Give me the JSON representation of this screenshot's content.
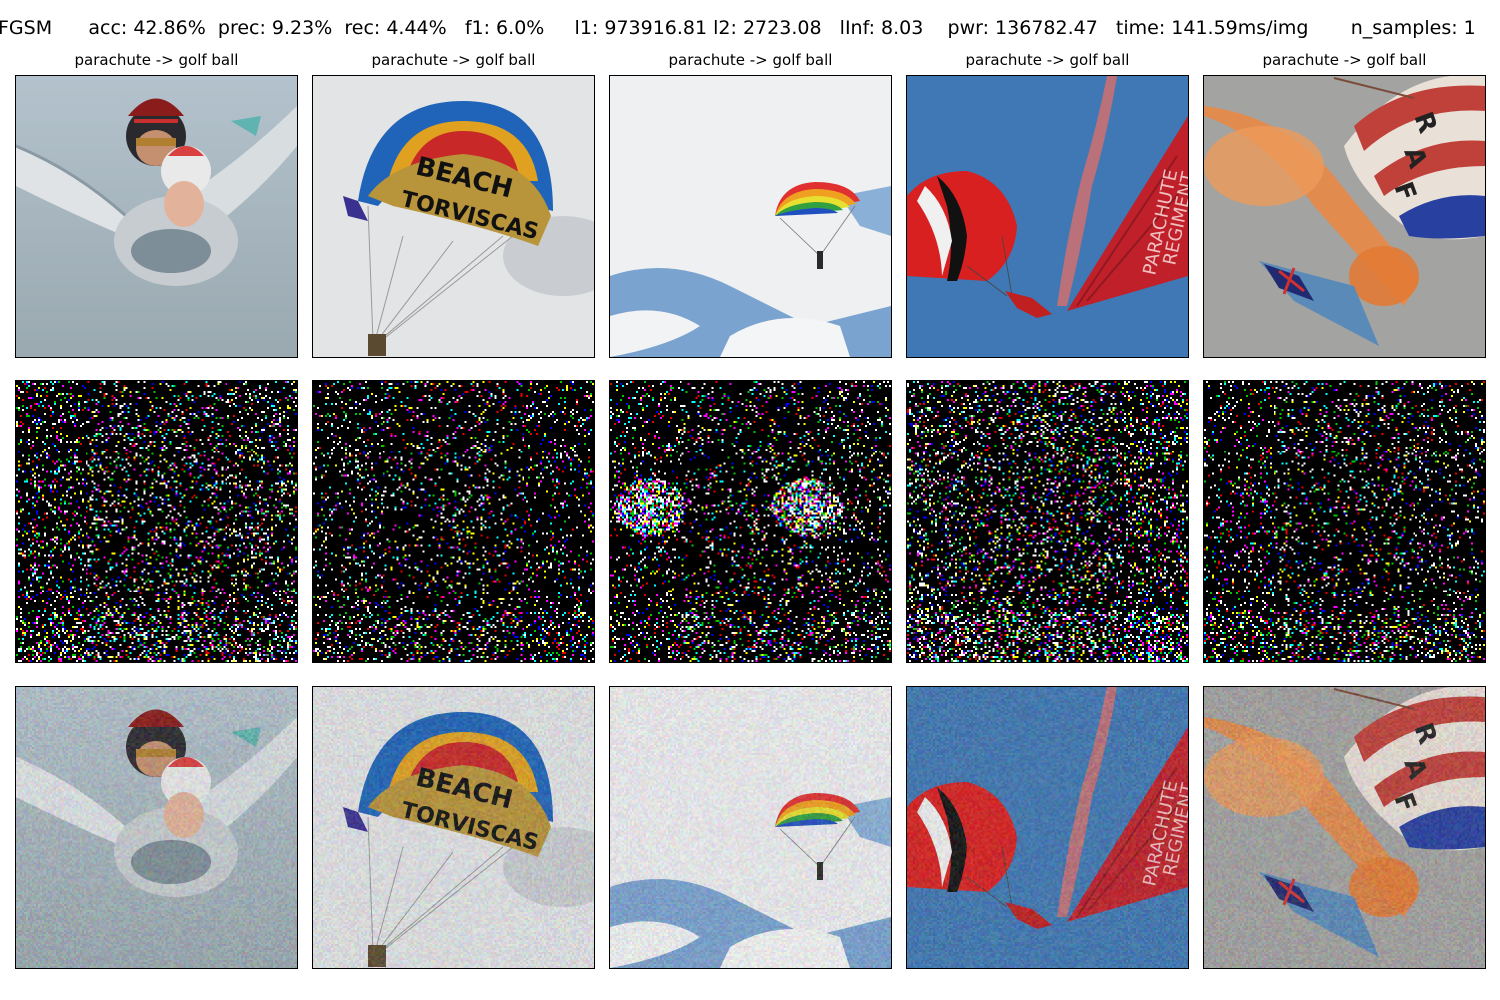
{
  "header": {
    "method": "FGSM",
    "acc": "acc: 42.86%",
    "prec": "prec: 9.23%",
    "rec": "rec: 4.44%",
    "f1": "f1: 6.0%",
    "l1": "l1: 973916.81",
    "l2": "l2: 2723.08",
    "linf": "lInf: 8.03",
    "pwr": "pwr: 136782.47",
    "time": "time: 141.59ms/img",
    "n_samples": "n_samples: 1"
  },
  "columns": [
    {
      "title": "parachute -> golf ball",
      "scene": "tandem-skydivers"
    },
    {
      "title": "parachute -> golf ball",
      "scene": "beach-parasail",
      "canopy_text": [
        "BEACH",
        "TORVISCAS"
      ]
    },
    {
      "title": "parachute -> golf ball",
      "scene": "rainbow-canopy-in-clouds"
    },
    {
      "title": "parachute -> golf ball",
      "scene": "parachute-regiment-flag",
      "flag_text": [
        "PARACHUTE",
        "REGIMENT"
      ]
    },
    {
      "title": "parachute -> golf ball",
      "scene": "raf-canopy-orange-smoke",
      "canopy_text": [
        "R",
        "A",
        "F"
      ]
    }
  ],
  "rows": [
    "original",
    "perturbation",
    "adversarial"
  ],
  "colors": {
    "sky_grey": "#a9b6c0",
    "parachute_red": "#d42a2a",
    "smoke_orange": "#e88a45",
    "noise_background": "#000000"
  }
}
